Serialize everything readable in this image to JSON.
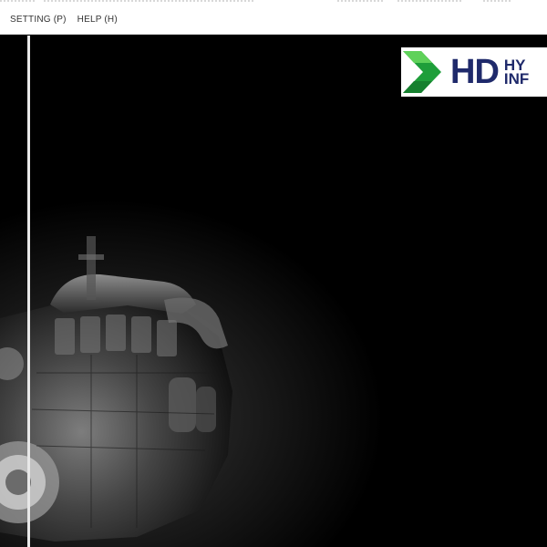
{
  "menubar": {
    "items": [
      {
        "label": "SETTING (P)"
      },
      {
        "label": "HELP (H)"
      }
    ]
  },
  "logo": {
    "mark_text": "HD",
    "line1": "HY",
    "line2": "INF",
    "colors": {
      "navy": "#1f2a6b",
      "green_dark": "#1e9e3a",
      "green_light": "#5fd15a"
    }
  },
  "background": {
    "image": "diesel-engine-illustration"
  }
}
